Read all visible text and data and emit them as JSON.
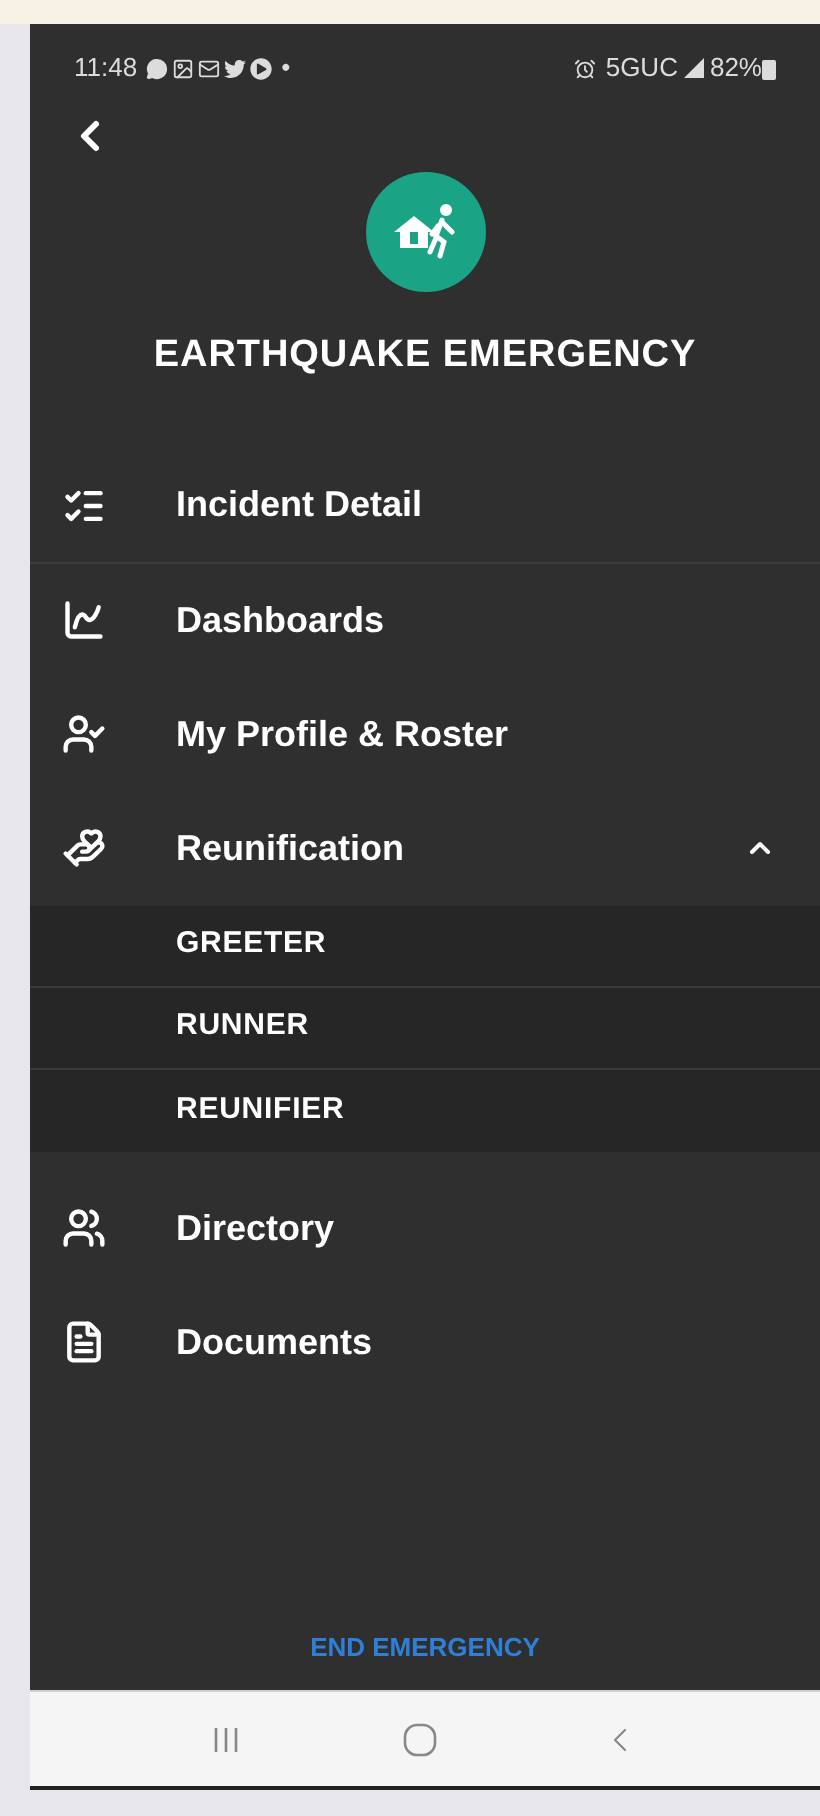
{
  "status_bar": {
    "time": "11:48",
    "dot": "•",
    "network": "5GUC",
    "battery": "82%"
  },
  "header": {
    "title": "EARTHQUAKE EMERGENCY"
  },
  "menu": [
    {
      "kind": "list",
      "label": "Incident Detail",
      "divider": true
    },
    {
      "kind": "chart",
      "label": "Dashboards",
      "divider": false
    },
    {
      "kind": "profile",
      "label": "My Profile & Roster",
      "divider": false
    },
    {
      "kind": "hands",
      "label": "Reunification",
      "divider": false,
      "expanded": true,
      "children": [
        {
          "label": "GREETER"
        },
        {
          "label": "RUNNER"
        },
        {
          "label": "REUNIFIER"
        }
      ]
    },
    {
      "kind": "people",
      "label": "Directory",
      "divider": false
    },
    {
      "kind": "document",
      "label": "Documents",
      "divider": false
    }
  ],
  "end_button": "END EMERGENCY"
}
